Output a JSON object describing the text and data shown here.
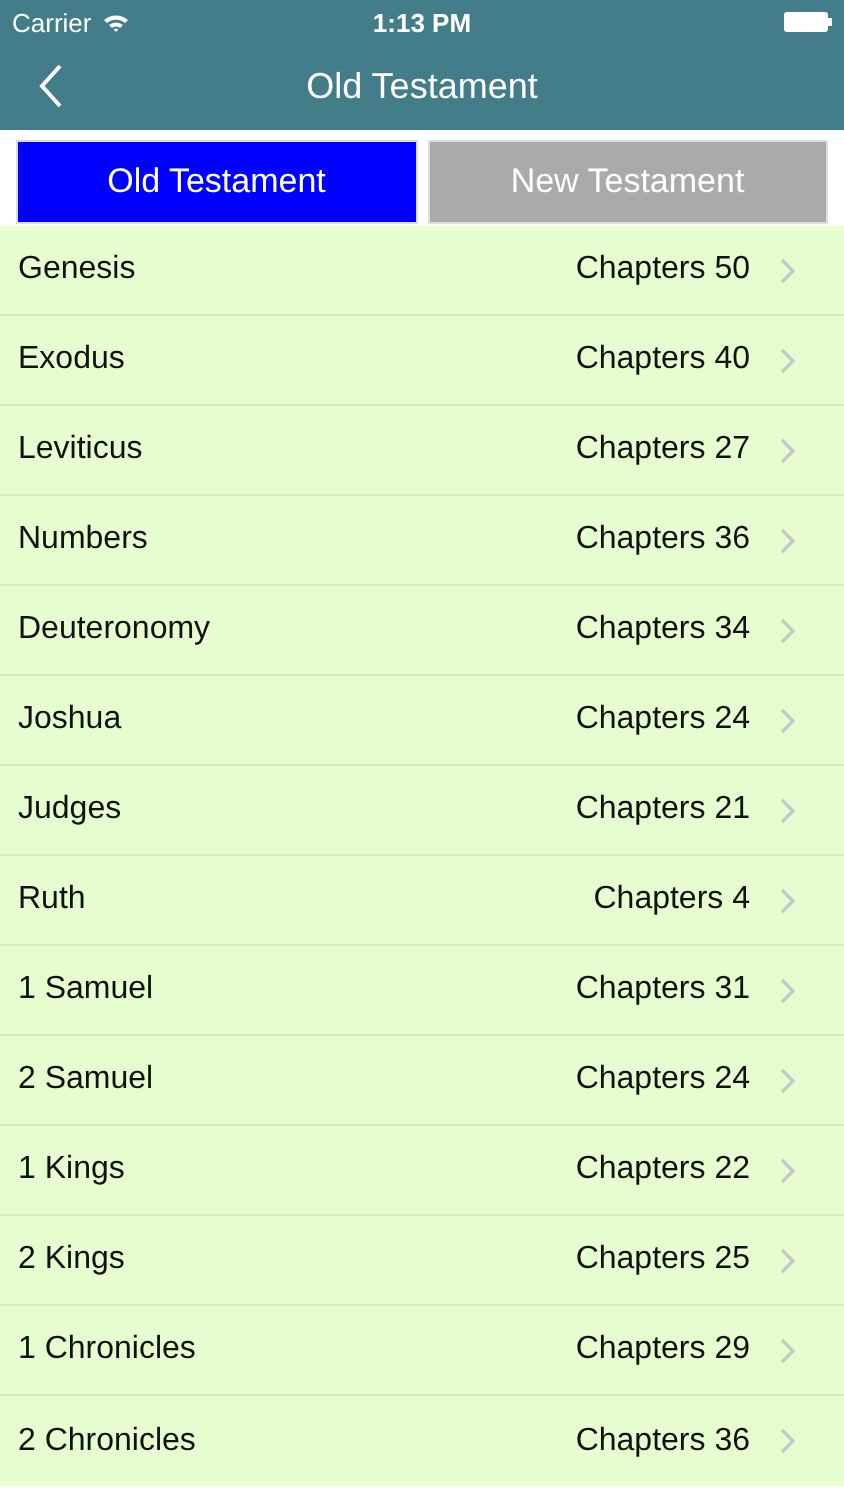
{
  "status_bar": {
    "carrier": "Carrier",
    "time": "1:13 PM"
  },
  "nav": {
    "title": "Old Testament"
  },
  "tabs": [
    {
      "label": "Old Testament",
      "selected": true
    },
    {
      "label": "New Testament",
      "selected": false
    }
  ],
  "books": [
    {
      "name": "Genesis",
      "chapters": "Chapters 50"
    },
    {
      "name": "Exodus",
      "chapters": "Chapters 40"
    },
    {
      "name": "Leviticus",
      "chapters": "Chapters 27"
    },
    {
      "name": "Numbers",
      "chapters": "Chapters 36"
    },
    {
      "name": "Deuteronomy",
      "chapters": "Chapters 34"
    },
    {
      "name": "Joshua",
      "chapters": "Chapters 24"
    },
    {
      "name": "Judges",
      "chapters": "Chapters 21"
    },
    {
      "name": "Ruth",
      "chapters": "Chapters 4"
    },
    {
      "name": "1 Samuel",
      "chapters": "Chapters 31"
    },
    {
      "name": "2 Samuel",
      "chapters": "Chapters 24"
    },
    {
      "name": "1 Kings",
      "chapters": "Chapters 22"
    },
    {
      "name": "2 Kings",
      "chapters": "Chapters 25"
    },
    {
      "name": "1 Chronicles",
      "chapters": "Chapters 29"
    },
    {
      "name": "2 Chronicles",
      "chapters": "Chapters 36"
    }
  ]
}
